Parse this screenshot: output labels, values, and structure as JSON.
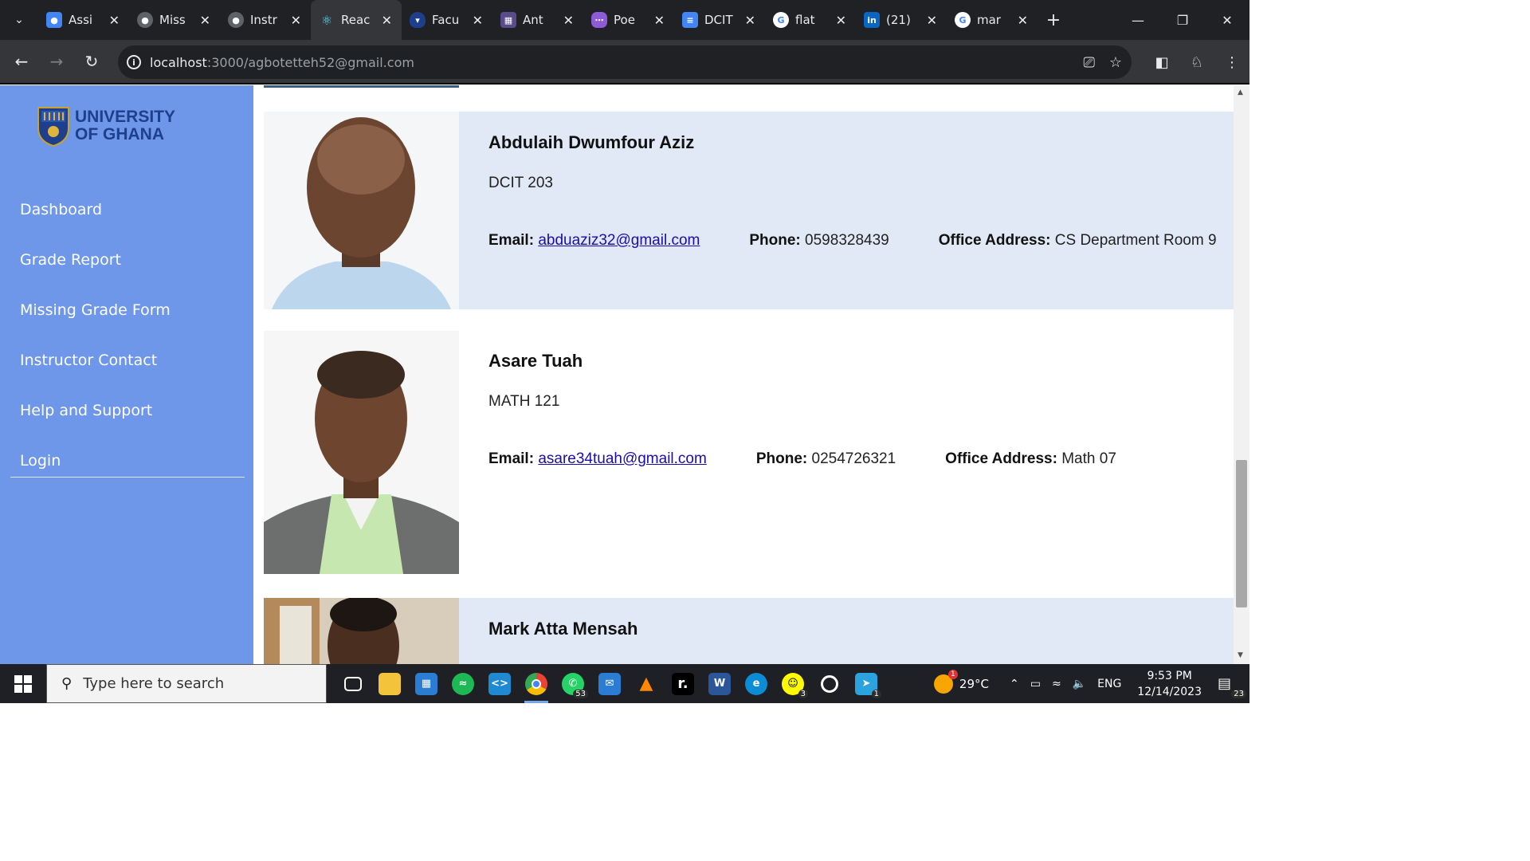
{
  "browser": {
    "tabs": [
      {
        "label": "Assi",
        "icon": "classroom-icon",
        "color": "#4285f4"
      },
      {
        "label": "Miss",
        "icon": "globe-icon",
        "color": "#5f6368"
      },
      {
        "label": "Instr",
        "icon": "globe-icon",
        "color": "#5f6368"
      },
      {
        "label": "Reac",
        "icon": "react-icon",
        "color": "#61dafb"
      },
      {
        "label": "Facu",
        "icon": "ug-icon",
        "color": "#1e3f8c"
      },
      {
        "label": "Ant",
        "icon": "calendar-icon",
        "color": "#5a4b8a"
      },
      {
        "label": "Poe",
        "icon": "poe-icon",
        "color": "#8f5ad6"
      },
      {
        "label": "DCIT",
        "icon": "docs-icon",
        "color": "#4285f4"
      },
      {
        "label": "flat",
        "icon": "google-icon",
        "color": "#ffffff"
      },
      {
        "label": "(21)",
        "icon": "linkedin-icon",
        "color": "#0a66c2"
      },
      {
        "label": "mar",
        "icon": "google-icon",
        "color": "#ffffff"
      }
    ],
    "url_host": "localhost",
    "url_path": ":3000/agbotetteh52@gmail.com"
  },
  "sidebar": {
    "logo_line1": "UNIVERSITY",
    "logo_line2": "OF GHANA",
    "items": [
      {
        "label": "Dashboard"
      },
      {
        "label": "Grade Report"
      },
      {
        "label": "Missing Grade Form"
      },
      {
        "label": "Instructor Contact"
      },
      {
        "label": "Help and Support"
      },
      {
        "label": "Login"
      }
    ]
  },
  "labels": {
    "email": "Email:",
    "phone": "Phone:",
    "office": "Office Address:"
  },
  "instructors": [
    {
      "name": "Abdulaih Dwumfour Aziz",
      "course": "DCIT 203",
      "email": "abduaziz32@gmail.com",
      "phone": "0598328439",
      "office": "CS Department Room 9"
    },
    {
      "name": "Asare Tuah",
      "course": "MATH 121",
      "email": "asare34tuah@gmail.com",
      "phone": "0254726321",
      "office": "Math 07"
    },
    {
      "name": "Mark Atta Mensah"
    }
  ],
  "taskbar": {
    "search_placeholder": "Type here to search",
    "whatsapp_badge": "53",
    "app_badge": "3",
    "telegram_badge": "1",
    "weather_alert": "1",
    "temperature": "29°C",
    "language": "ENG",
    "time": "9:53 PM",
    "date": "12/14/2023",
    "notifications": "23"
  }
}
